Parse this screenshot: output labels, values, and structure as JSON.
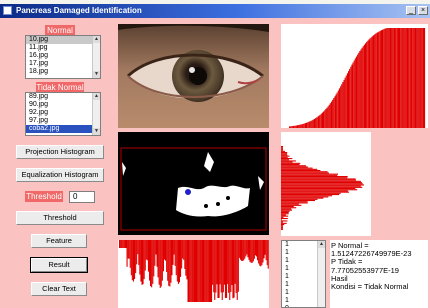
{
  "window": {
    "title": "Pancreas Damaged Identification",
    "controls": {
      "minimize": "_",
      "close": "×"
    }
  },
  "normal": {
    "label": "Normal",
    "files": [
      "10.jpg",
      "11.jpg",
      "16.jpg",
      "17.jpg",
      "18.jpg"
    ],
    "selected_index": 0
  },
  "abnormal": {
    "label": "Tidak Normal",
    "files": [
      "89.jpg",
      "90.jpg",
      "92.jpg",
      "97.jpg",
      "coba2.jpg"
    ],
    "selected_index": 4
  },
  "buttons": {
    "projection": "Projection Histogram",
    "equalization": "Equalization Histogram",
    "threshold": "Threshold",
    "feature": "Feature",
    "result": "Result",
    "clear": "Clear Text"
  },
  "threshold_input": {
    "label": "Threshold",
    "value": "0"
  },
  "feature_values": [
    "1",
    "1",
    "1",
    "1",
    "1",
    "1",
    "1",
    "1",
    "0"
  ],
  "result_lines": [
    "P Normal =",
    "1.51247226749979E-23",
    "P Tidak =",
    "7.77052553977E-19",
    "Hasil",
    "Kondisi = Tidak Normal"
  ],
  "colors": {
    "background": "#fbc2c2",
    "accent": "#f06868",
    "histogram": "#e00000"
  }
}
